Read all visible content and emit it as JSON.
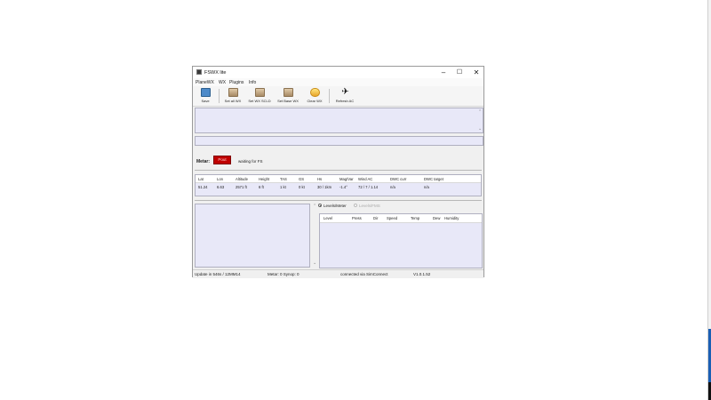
{
  "window": {
    "title": "FSWX lite",
    "controls": {
      "minimize": "–",
      "maximize": "☐",
      "close": "✕"
    }
  },
  "menu": [
    "PlaneWX",
    "WX",
    "Plugins",
    "Info"
  ],
  "toolbar": {
    "buttons": [
      {
        "label": "Save",
        "icon": "save-icon"
      },
      {
        "label": "Set all WX",
        "icon": "fs-icon"
      },
      {
        "label": "Set WX SCLD",
        "icon": "fs-icon"
      },
      {
        "label": "Set Base WX",
        "icon": "fs-icon"
      },
      {
        "label": "Clear WX",
        "icon": "clear-weather-icon"
      },
      {
        "label": "Refresh AC",
        "icon": "plane-icon"
      }
    ]
  },
  "metar": {
    "label": "Metar:",
    "indicator": "Pout",
    "status": "waiting for FS"
  },
  "grid": {
    "headers": [
      "Lat",
      "Lon",
      "Altitude",
      "Height",
      "TAS",
      "GS",
      "Hs",
      "Mag/Var",
      "Wind AC",
      "DWC curr",
      "DWC target"
    ],
    "row": [
      "51.24",
      "6.63",
      "2571 ft",
      "6 ft",
      "1 kt",
      "0 kt",
      "30 / 1km",
      "-1.4°",
      "72 / 7 / 1.14",
      "n/a",
      "n/a"
    ]
  },
  "levels": {
    "options": [
      {
        "label": "Levels/Meter",
        "selected": true
      },
      {
        "label": "Levels/FMS",
        "selected": false
      }
    ],
    "headers": [
      "Level",
      "Press",
      "Dir",
      "Speed",
      "Temp",
      "Dew",
      "Humidity"
    ]
  },
  "status": {
    "update": "Update in 546s / 12MM14",
    "metar": "Metar: 0 Synop: 0",
    "connection": "connected via SimConnect",
    "version": "V1.0.1.52"
  },
  "colors": {
    "panel_bg": "#e8e8f8",
    "metar_indicator": "#c00000",
    "accent": "#1a5fb4"
  }
}
